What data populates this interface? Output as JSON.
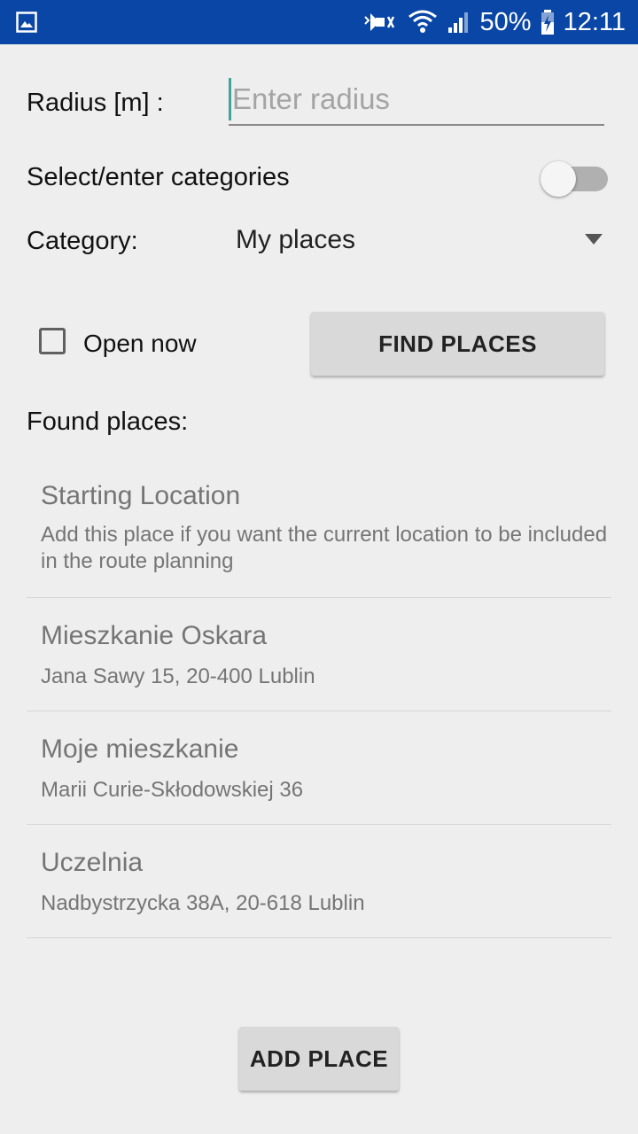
{
  "status_bar": {
    "battery_text": "50%",
    "time": "12:11",
    "icons": [
      "gallery-notification-icon",
      "mute-icon",
      "wifi-icon",
      "signal-icon",
      "battery-charging-icon"
    ]
  },
  "form": {
    "radius_label": "Radius [m] :",
    "radius_placeholder": "Enter radius",
    "radius_value": "",
    "categories_toggle_label": "Select/enter categories",
    "categories_toggle_on": false,
    "category_label": "Category:",
    "category_selected": "My places",
    "open_now_label": "Open now",
    "open_now_checked": false,
    "find_places_button": "FIND PLACES"
  },
  "results": {
    "heading": "Found places:",
    "items": [
      {
        "title": "Starting Location",
        "subtitle": "Add this place if you want the current location to be included in the route planning"
      },
      {
        "title": "Mieszkanie Oskara",
        "subtitle": "Jana Sawy 15, 20-400 Lublin"
      },
      {
        "title": "Moje mieszkanie",
        "subtitle": "Marii Curie-Skłodowskiej 36"
      },
      {
        "title": "Uczelnia",
        "subtitle": "Nadbystrzycka 38A, 20-618 Lublin"
      }
    ]
  },
  "add_place_button": "ADD PLACE",
  "colors": {
    "status_bar": "#0a46a5",
    "background": "#eeeeee",
    "accent": "#3fa39a",
    "button": "#d9d9d9"
  }
}
